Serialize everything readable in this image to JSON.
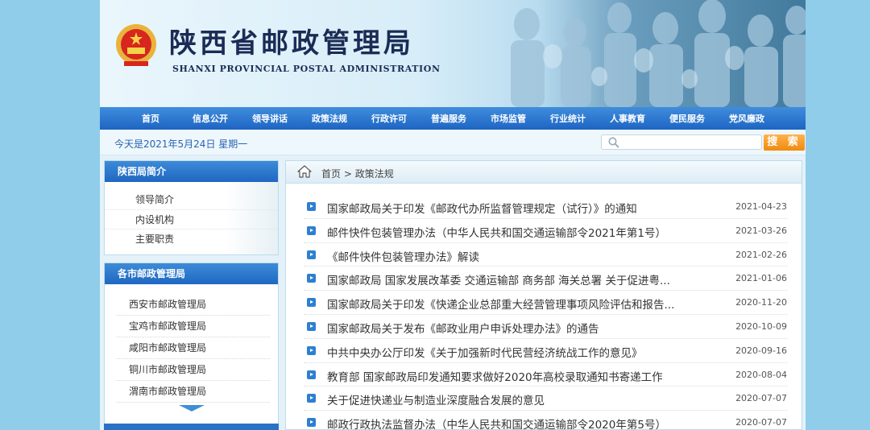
{
  "header": {
    "title": "陕西省邮政管理局",
    "subtitle": "SHANXI PROVINCIAL POSTAL ADMINISTRATION"
  },
  "nav": [
    "首页",
    "信息公开",
    "领导讲话",
    "政策法规",
    "行政许可",
    "普遍服务",
    "市场监管",
    "行业统计",
    "人事教育",
    "便民服务",
    "党风廉政"
  ],
  "datebar": {
    "date_text": "今天是2021年5月24日   星期一",
    "search_value": "",
    "search_button": "搜 索"
  },
  "sidebar": {
    "intro": {
      "title": "陕西局简介",
      "items": [
        "领导简介",
        "内设机构",
        "主要职责"
      ]
    },
    "cities": {
      "title": "各市邮政管理局",
      "items": [
        "西安市邮政管理局",
        "宝鸡市邮政管理局",
        "咸阳市邮政管理局",
        "铜川市邮政管理局",
        "渭南市邮政管理局"
      ]
    }
  },
  "breadcrumb": {
    "home": "首页",
    "separator": ">",
    "current": "政策法规"
  },
  "articles": [
    {
      "title": "国家邮政局关于印发《邮政代办所监督管理规定（试行）》的通知",
      "date": "2021-04-23"
    },
    {
      "title": "邮件快件包装管理办法（中华人民共和国交通运输部令2021年第1号）",
      "date": "2021-03-26"
    },
    {
      "title": "《邮件快件包装管理办法》解读",
      "date": "2021-02-26"
    },
    {
      "title": "国家邮政局 国家发展改革委 交通运输部 商务部 海关总署 关于促进粤...",
      "date": "2021-01-06"
    },
    {
      "title": "国家邮政局关于印发《快递企业总部重大经营管理事项风险评估和报告...",
      "date": "2020-11-20"
    },
    {
      "title": "国家邮政局关于发布《邮政业用户申诉处理办法》的通告",
      "date": "2020-10-09"
    },
    {
      "title": "中共中央办公厅印发《关于加强新时代民营经济统战工作的意见》",
      "date": "2020-09-16"
    },
    {
      "title": "教育部 国家邮政局印发通知要求做好2020年高校录取通知书寄递工作",
      "date": "2020-08-04"
    },
    {
      "title": "关于促进快递业与制造业深度融合发展的意见",
      "date": "2020-07-07"
    },
    {
      "title": "邮政行政执法监督办法（中华人民共和国交通运输部令2020年第5号）",
      "date": "2020-07-07"
    }
  ],
  "colors": {
    "nav": "#1e65c3",
    "search_button": "#f08a10",
    "title": "#1a2c55",
    "date_text": "#2a64b2"
  }
}
